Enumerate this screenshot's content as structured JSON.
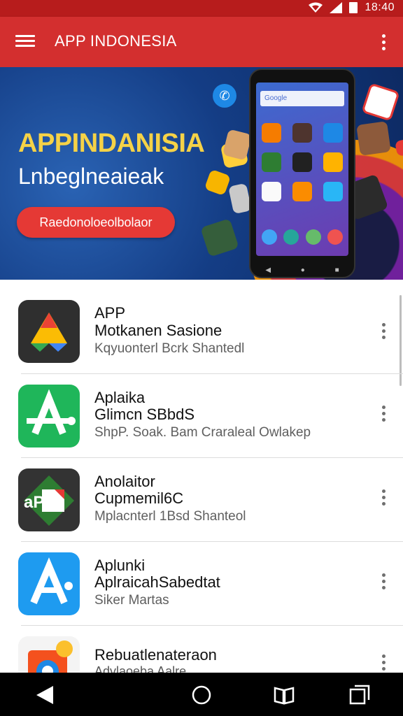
{
  "status_bar": {
    "time": "18:40",
    "icons": [
      "wifi-icon",
      "signal-icon",
      "battery-icon"
    ]
  },
  "app_bar": {
    "title": "APP INDONESIA",
    "menu_icon": "hamburger-icon",
    "overflow_icon": "more-vert-icon"
  },
  "banner": {
    "title": "APPINDANISIA",
    "subtitle": "Lnbeglneaieak",
    "cta_label": "Raedonoloeolbolaor",
    "phone_search": "Google"
  },
  "apps": [
    {
      "title": "APP",
      "subtitle": "Motkanen Sasione",
      "meta": "Kqyuonterl Bcrk  Shantedl",
      "icon": "google-drive-style-icon"
    },
    {
      "title": "Aplaika",
      "subtitle": "Glimcn SBbdS",
      "meta": "ShpP. Soak. Bam Craraleal Owlakep",
      "icon": "green-a-app-icon"
    },
    {
      "title": "Anolaitor",
      "subtitle": "Cupmemil6C",
      "meta": "Mplacnterl 1Bsd  Shanteol",
      "icon": "app-flag-icon"
    },
    {
      "title": "Aplunki",
      "subtitle": "AplraicahSabedtat",
      "meta": "Siker Martas",
      "icon": "blue-a-app-icon"
    },
    {
      "title": "Rebuatlenateraon",
      "subtitle": "Advlaoeba Aalre",
      "meta": "",
      "icon": "photo-app-icon"
    }
  ],
  "nav": {
    "back": "back-icon",
    "home": "home-icon",
    "books": "book-icon",
    "recents": "recents-icon"
  },
  "colors": {
    "status_bar": "#b71c1c",
    "app_bar": "#d32f2f",
    "accent": "#e53935",
    "banner_bg": "#143d85",
    "banner_title": "#f5d247"
  }
}
